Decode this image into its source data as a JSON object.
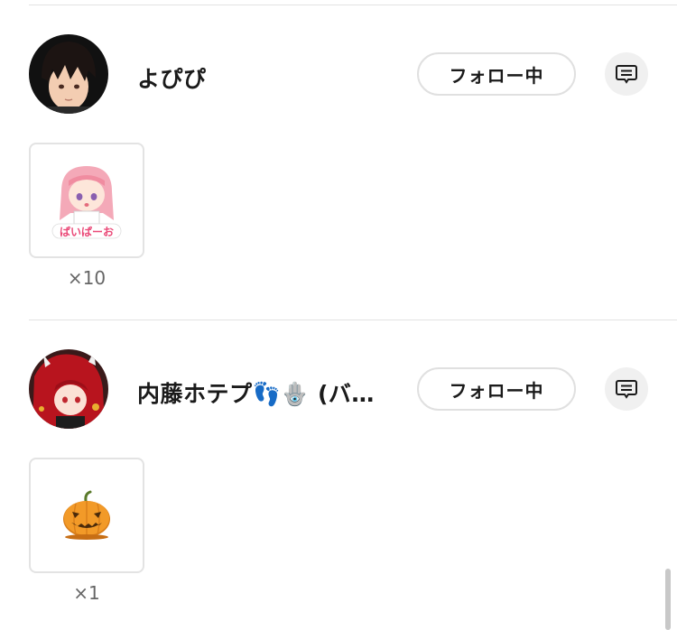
{
  "entries": [
    {
      "username": "よぴぴ",
      "follow_label": "フォロー中",
      "avatar_icon": "anime-boy-avatar",
      "gift_icon": "pink-hair-girl-sticker",
      "gift_count": "×10"
    },
    {
      "username": "内藤ホテプ👣🪬 (バ…",
      "follow_label": "フォロー中",
      "avatar_icon": "red-hair-character-avatar",
      "gift_icon": "pumpkin-icon",
      "gift_count": "×1"
    }
  ],
  "colors": {
    "divider": "#e3e3e3",
    "button_border": "#e0e0e0",
    "message_bg": "#f0f0f0",
    "count_text": "#666666"
  }
}
